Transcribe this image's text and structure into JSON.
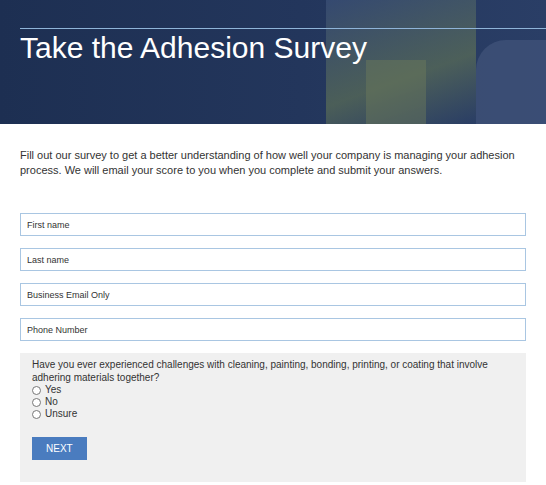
{
  "header": {
    "title": "Take the Adhesion Survey"
  },
  "intro": "Fill out our survey to get a better understanding of how well your company is managing your adhesion process. We will email your score to you when you complete and submit your answers.",
  "fields": [
    {
      "placeholder": "First name"
    },
    {
      "placeholder": "Last name"
    },
    {
      "placeholder": "Business Email Only"
    },
    {
      "placeholder": "Phone Number"
    }
  ],
  "question": {
    "text": "Have you ever experienced challenges with cleaning, painting, bonding, printing, or coating that involve adhering materials together?",
    "options": [
      {
        "label": "Yes",
        "selected": false
      },
      {
        "label": "No",
        "selected": false
      },
      {
        "label": "Unsure",
        "selected": false
      }
    ]
  },
  "buttons": [
    "NEXT"
  ]
}
